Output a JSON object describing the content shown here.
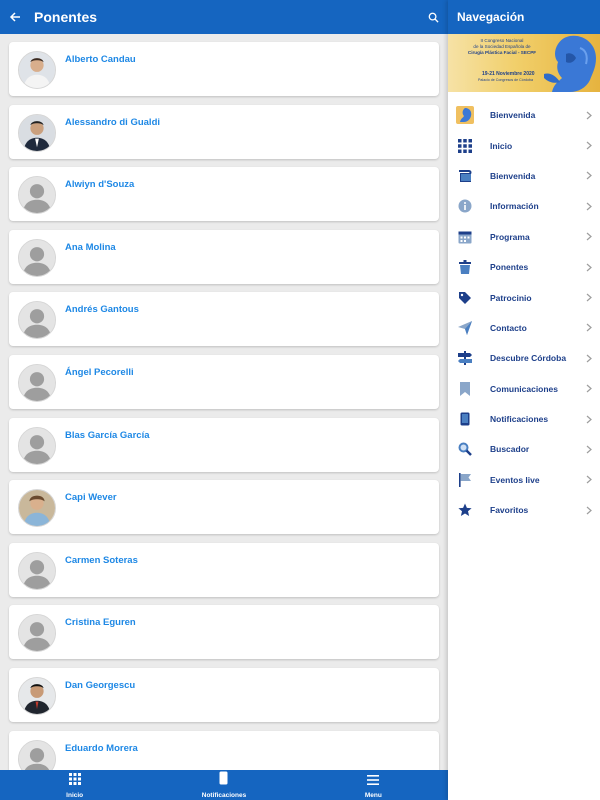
{
  "header": {
    "title": "Ponentes",
    "back_icon": "arrow-left-icon",
    "search_icon": "search-icon"
  },
  "speakers": [
    {
      "name": "Alberto Candau",
      "photo": true
    },
    {
      "name": "Alessandro di Gualdi",
      "photo": true
    },
    {
      "name": "Alwiyn d'Souza",
      "photo": false
    },
    {
      "name": "Ana Molina",
      "photo": false
    },
    {
      "name": "Andrés Gantous",
      "photo": false
    },
    {
      "name": "Ángel Pecorelli",
      "photo": false
    },
    {
      "name": "Blas García García",
      "photo": false
    },
    {
      "name": "Capi Wever",
      "photo": true
    },
    {
      "name": "Carmen Soteras",
      "photo": false
    },
    {
      "name": "Cristina Eguren",
      "photo": false
    },
    {
      "name": "Dan Georgescu",
      "photo": true
    },
    {
      "name": "Eduardo Morera",
      "photo": false
    }
  ],
  "tabbar": {
    "items": [
      {
        "label": "Inicio",
        "icon": "grid-icon"
      },
      {
        "label": "Notificaciones",
        "icon": "phone-icon"
      },
      {
        "label": "Menu",
        "icon": "hamburger-icon"
      }
    ]
  },
  "drawer": {
    "title": "Navegación",
    "banner": {
      "lines": [
        "II Congreso Nacional",
        "de la Sociedad Española de",
        "Cirugía Plástica Facial - SECPF"
      ],
      "date": "19-21 Noviembre 2020",
      "venue": "Palacio de Congresos de Córdoba"
    },
    "items": [
      {
        "label": "Bienvenida",
        "icon": "welcome-image-icon"
      },
      {
        "label": "Inicio",
        "icon": "grid-icon"
      },
      {
        "label": "Bienvenida",
        "icon": "scroll-icon"
      },
      {
        "label": "Información",
        "icon": "info-icon"
      },
      {
        "label": "Programa",
        "icon": "calendar-icon"
      },
      {
        "label": "Ponentes",
        "icon": "podium-icon"
      },
      {
        "label": "Patrocinio",
        "icon": "tag-icon"
      },
      {
        "label": "Contacto",
        "icon": "paper-plane-icon"
      },
      {
        "label": "Descubre Córdoba",
        "icon": "signpost-icon"
      },
      {
        "label": "Comunicaciones",
        "icon": "bookmark-icon"
      },
      {
        "label": "Notificaciones",
        "icon": "mobile-icon"
      },
      {
        "label": "Buscador",
        "icon": "magnifier-icon"
      },
      {
        "label": "Eventos live",
        "icon": "flag-icon"
      },
      {
        "label": "Favoritos",
        "icon": "star-icon"
      }
    ]
  },
  "colors": {
    "primary": "#1565c0",
    "link": "#1e88e5",
    "nav_text": "#1d3f8a",
    "background": "#ebebeb"
  }
}
